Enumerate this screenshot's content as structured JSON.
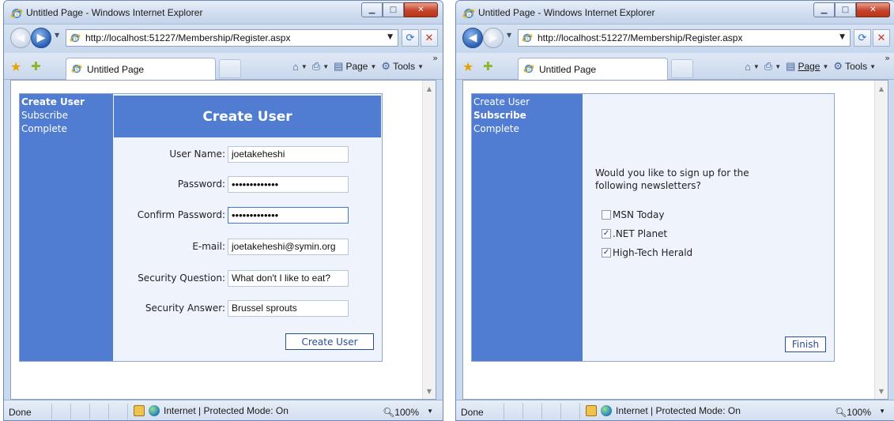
{
  "left_window": {
    "title": "Untitled Page - Windows Internet Explorer",
    "url": "http://localhost:51227/Membership/Register.aspx",
    "tab_label": "Untitled Page",
    "commands": {
      "page": "Page",
      "tools": "Tools"
    },
    "sidebar": [
      "Create User",
      "Subscribe",
      "Complete"
    ],
    "create_user": {
      "header": "Create User",
      "fields": [
        {
          "label": "User Name:",
          "value": "joetakeheshi"
        },
        {
          "label": "Password:",
          "value": "•••••••••••••"
        },
        {
          "label": "Confirm Password:",
          "value": "•••••••••••••"
        },
        {
          "label": "E-mail:",
          "value": "joetakeheshi@symin.org"
        },
        {
          "label": "Security Question:",
          "value": "What don't I like to eat?"
        },
        {
          "label": "Security Answer:",
          "value": "Brussel sprouts"
        }
      ],
      "button": "Create User"
    },
    "status": {
      "done": "Done",
      "zone": "Internet | Protected Mode: On",
      "zoom": "100%"
    }
  },
  "right_window": {
    "title": "Untitled Page - Windows Internet Explorer",
    "url": "http://localhost:51227/Membership/Register.aspx",
    "tab_label": "Untitled Page",
    "commands": {
      "page": "Page",
      "tools": "Tools"
    },
    "sidebar": [
      "Create User",
      "Subscribe",
      "Complete"
    ],
    "subscribe": {
      "question": "Would you like to sign up for the following newsletters?",
      "options": [
        {
          "label": "MSN Today",
          "checked": false
        },
        {
          "label": ".NET Planet",
          "checked": true
        },
        {
          "label": "High-Tech Herald",
          "checked": true
        }
      ],
      "finish": "Finish"
    },
    "status": {
      "done": "Done",
      "zone": "Internet | Protected Mode: On",
      "zoom": "100%"
    }
  },
  "colors": {
    "wizard_blue": "#507cd1",
    "button_text": "#284e98"
  },
  "icons": [
    "ie-icon",
    "minimize-icon",
    "maximize-icon",
    "close-icon",
    "back-icon",
    "forward-icon",
    "refresh-icon",
    "stop-icon",
    "favorites-star-icon",
    "add-favorites-icon",
    "home-icon",
    "print-icon",
    "page-icon",
    "tools-gear-icon",
    "lock-icon",
    "globe-icon",
    "zoom-icon"
  ]
}
